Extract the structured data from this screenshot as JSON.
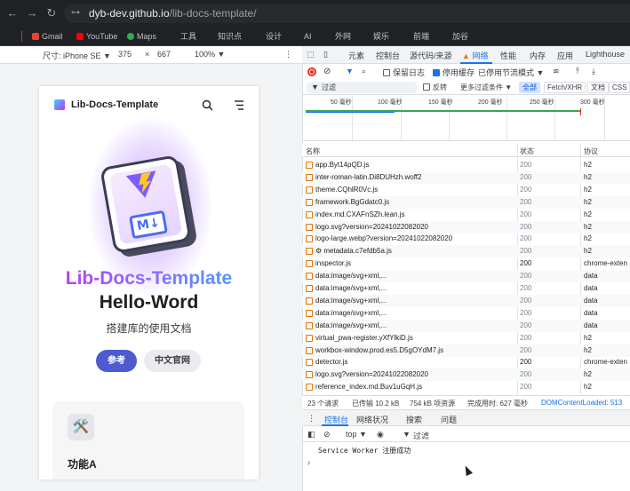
{
  "browser": {
    "url_host": "dyb-dev.github.io",
    "url_path": "/lib-docs-template/",
    "bookmarks": [
      "Gmail",
      "YouTube",
      "Maps",
      "工具",
      "知识点",
      "设计",
      "AI",
      "外网",
      "娱乐",
      "前端",
      "加谷"
    ]
  },
  "device_toolbar": {
    "device_label": "尺寸: iPhone SE ▼",
    "width": "375",
    "x": "×",
    "height": "667",
    "zoom": "100% ▼"
  },
  "site": {
    "name": "Lib-Docs-Template",
    "hero_name": "Lib-Docs-Template",
    "hero_text": "Hello-Word",
    "tagline": "搭建库的使用文档",
    "btn_primary": "参考",
    "btn_secondary": "中文官网",
    "feature_icon": "🛠️",
    "feature_title": "功能A",
    "md_label": "M↓"
  },
  "devtools": {
    "tabs": [
      "元素",
      "控制台",
      "源代码/来源",
      "网络",
      "性能",
      "内存",
      "应用",
      "Lighthouse"
    ],
    "active_tab": "网络",
    "toolbar": {
      "preserve_log": "保留日志",
      "disable_cache": "停用缓存",
      "throttle": "已停用节流模式 ▼"
    },
    "filter": {
      "placeholder": "过滤",
      "invert": "反转",
      "more": "更多过滤条件 ▼",
      "all": "全部",
      "fetch": "Fetch/XHR",
      "doc": "文档",
      "css": "CSS"
    },
    "ticks": [
      "50 毫秒",
      "100 毫秒",
      "150 毫秒",
      "200 毫秒",
      "250 毫秒",
      "300 毫秒"
    ],
    "headers": {
      "name": "名称",
      "status": "状态",
      "protocol": "协议"
    },
    "rows": [
      {
        "name": "app.Byt14pQD.js",
        "status": "200",
        "protocol": "h2"
      },
      {
        "name": "inter-roman-latin.Di8DUHzh.woff2",
        "status": "200",
        "protocol": "h2"
      },
      {
        "name": "theme.CQhlR0Vc.js",
        "status": "200",
        "protocol": "h2"
      },
      {
        "name": "framework.BgGdatc0.js",
        "status": "200",
        "protocol": "h2"
      },
      {
        "name": "index.md.CXAFnSZh.lean.js",
        "status": "200",
        "protocol": "h2"
      },
      {
        "name": "logo.svg?version=20241022082020",
        "status": "200",
        "protocol": "h2"
      },
      {
        "name": "logo-large.webp?version=20241022082020",
        "status": "200",
        "protocol": "h2"
      },
      {
        "name": "⚙ metadata.c7efdb5a.js",
        "status": "200",
        "protocol": "h2"
      },
      {
        "name": "inspector.js",
        "status": "200",
        "protocol": "chrome-exten"
      },
      {
        "name": "data:image/svg+xml,...",
        "status": "200",
        "protocol": "data"
      },
      {
        "name": "data:image/svg+xml,...",
        "status": "200",
        "protocol": "data"
      },
      {
        "name": "data:image/svg+xml,...",
        "status": "200",
        "protocol": "data"
      },
      {
        "name": "data:image/svg+xml,...",
        "status": "200",
        "protocol": "data"
      },
      {
        "name": "data:image/svg+xml,...",
        "status": "200",
        "protocol": "data"
      },
      {
        "name": "virtual_pwa-register.yXfYlkiD.js",
        "status": "200",
        "protocol": "h2"
      },
      {
        "name": "workbox-window.prod.es5.D5gOYdM7.js",
        "status": "200",
        "protocol": "h2"
      },
      {
        "name": "detector.js",
        "status": "200",
        "protocol": "chrome-exten"
      },
      {
        "name": "logo.svg?version=20241022082020",
        "status": "200",
        "protocol": "h2"
      },
      {
        "name": "reference_index.md.Buv1uGqH.js",
        "status": "200",
        "protocol": "h2"
      }
    ],
    "status_bar": {
      "requests": "23 个请求",
      "transferred": "已传输 10.2 kB",
      "resources": "754 kB 项资源",
      "finish": "完成用时: 627 毫秒",
      "dcl": "DOMContentLoaded: 513"
    },
    "drawer_tabs": [
      "控制台",
      "网络状况",
      "搜索",
      "问题"
    ],
    "console": {
      "context": "top ▼",
      "filter": "过滤",
      "message": "Service Worker 注册成功",
      "prompt": "›"
    }
  }
}
